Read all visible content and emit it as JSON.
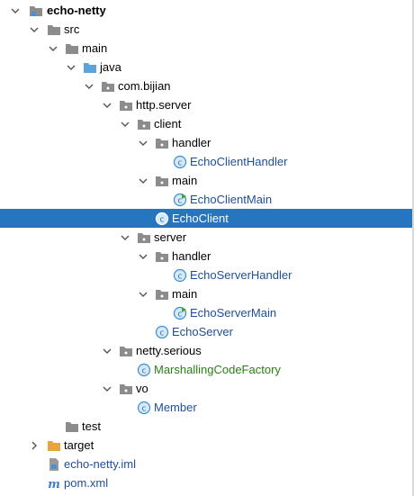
{
  "colors": {
    "selection": "#2675bf",
    "folder": "#8c8c8c",
    "source_folder": "#5ba3dc",
    "target_folder": "#e8a33c",
    "class_circle": "#3d8fd1",
    "class_blue_text": "#1f4e9a",
    "class_green_text": "#2a7f14"
  },
  "tree": {
    "project": {
      "label": "echo-netty",
      "icon": "module-folder-icon"
    },
    "src": {
      "label": "src"
    },
    "main": {
      "label": "main"
    },
    "java": {
      "label": "java"
    },
    "package": {
      "label": "com.bijian"
    },
    "http_server": {
      "label": "http.server"
    },
    "client": {
      "label": "client"
    },
    "client_handler": {
      "label": "handler"
    },
    "echo_client_handler": {
      "label": "EchoClientHandler",
      "icon": "java-class-icon"
    },
    "client_main": {
      "label": "main"
    },
    "echo_client_main": {
      "label": "EchoClientMain",
      "icon": "java-runnable-class-icon"
    },
    "echo_client": {
      "label": "EchoClient",
      "icon": "java-class-icon",
      "selected": true
    },
    "server": {
      "label": "server"
    },
    "server_handler": {
      "label": "handler"
    },
    "echo_server_handler": {
      "label": "EchoServerHandler",
      "icon": "java-class-icon"
    },
    "server_main": {
      "label": "main"
    },
    "echo_server_main": {
      "label": "EchoServerMain",
      "icon": "java-runnable-class-icon"
    },
    "echo_server": {
      "label": "EchoServer",
      "icon": "java-class-icon"
    },
    "netty_serious": {
      "label": "netty.serious"
    },
    "marshalling": {
      "label": "MarshallingCodeFactory",
      "icon": "java-class-icon"
    },
    "vo": {
      "label": "vo"
    },
    "member": {
      "label": "Member",
      "icon": "java-class-icon"
    },
    "test": {
      "label": "test"
    },
    "target": {
      "label": "target",
      "icon": "excluded-folder-icon"
    },
    "iml": {
      "label": "echo-netty.iml",
      "icon": "iml-file-icon"
    },
    "pom": {
      "label": "pom.xml",
      "icon": "maven-icon"
    }
  }
}
